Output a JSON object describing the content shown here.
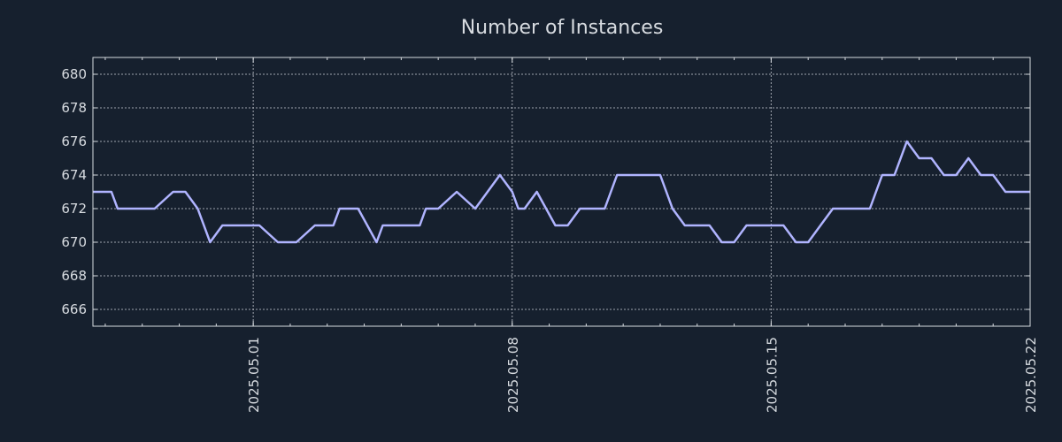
{
  "chart_data": {
    "type": "line",
    "title": "Number of Instances",
    "xlabel": "",
    "ylabel": "",
    "xlim": [
      "2025-04-26T16:00",
      "2025-05-22T00:00"
    ],
    "ylim": [
      665,
      681
    ],
    "yticks": [
      666,
      668,
      670,
      672,
      674,
      676,
      678,
      680
    ],
    "xticks": [
      "2025.05.01",
      "2025.05.08",
      "2025.05.15",
      "2025.05.22"
    ],
    "grid": true,
    "legend": "none",
    "line_color": "#b0b4ff",
    "series": [
      {
        "x": [
          "2025-04-26T16:00",
          "2025-04-27T04:00",
          "2025-04-27T08:00",
          "2025-04-27T20:00",
          "2025-04-28T08:00",
          "2025-04-28T20:00",
          "2025-04-29T04:00",
          "2025-04-29T12:00",
          "2025-04-29T20:00",
          "2025-04-30T04:00",
          "2025-04-30T08:00",
          "2025-04-30T12:00",
          "2025-04-30T20:00",
          "2025-05-01T04:00",
          "2025-05-01T16:00",
          "2025-05-02T04:00",
          "2025-05-02T16:00",
          "2025-05-03T04:00",
          "2025-05-03T08:00",
          "2025-05-03T20:00",
          "2025-05-04T08:00",
          "2025-05-04T12:00",
          "2025-05-04T20:00",
          "2025-05-05T04:00",
          "2025-05-05T12:00",
          "2025-05-05T16:00",
          "2025-05-06T00:00",
          "2025-05-06T12:00",
          "2025-05-07T00:00",
          "2025-05-07T08:00",
          "2025-05-07T16:00",
          "2025-05-08T00:00",
          "2025-05-08T04:00",
          "2025-05-08T08:00",
          "2025-05-08T16:00",
          "2025-05-09T04:00",
          "2025-05-09T12:00",
          "2025-05-09T20:00",
          "2025-05-10T04:00",
          "2025-05-10T12:00",
          "2025-05-10T20:00",
          "2025-05-11T04:00",
          "2025-05-11T08:00",
          "2025-05-11T12:00",
          "2025-05-11T16:00",
          "2025-05-12T00:00",
          "2025-05-12T08:00",
          "2025-05-12T16:00",
          "2025-05-13T00:00",
          "2025-05-13T08:00",
          "2025-05-13T16:00",
          "2025-05-14T00:00",
          "2025-05-14T08:00",
          "2025-05-14T16:00",
          "2025-05-15T00:00",
          "2025-05-15T08:00",
          "2025-05-15T16:00",
          "2025-05-16T00:00",
          "2025-05-16T08:00",
          "2025-05-16T16:00",
          "2025-05-17T00:00",
          "2025-05-17T08:00",
          "2025-05-17T16:00",
          "2025-05-18T00:00",
          "2025-05-18T08:00",
          "2025-05-18T16:00",
          "2025-05-19T00:00",
          "2025-05-19T08:00",
          "2025-05-19T16:00",
          "2025-05-20T00:00",
          "2025-05-20T08:00",
          "2025-05-20T16:00",
          "2025-05-21T00:00",
          "2025-05-21T08:00",
          "2025-05-21T16:00",
          "2025-05-22T00:00"
        ],
        "y": [
          673,
          673,
          672,
          672,
          672,
          673,
          673,
          672,
          670,
          671,
          671,
          671,
          671,
          671,
          670,
          670,
          671,
          671,
          672,
          672,
          670,
          671,
          671,
          671,
          671,
          672,
          672,
          673,
          672,
          673,
          674,
          673,
          672,
          672,
          673,
          671,
          671,
          672,
          672,
          672,
          674,
          674,
          674,
          674,
          674,
          674,
          672,
          671,
          671,
          671,
          670,
          670,
          671,
          671,
          671,
          671,
          670,
          670,
          671,
          672,
          672,
          672,
          672,
          674,
          674,
          676,
          675,
          675,
          674,
          674,
          675,
          674,
          674,
          673,
          673,
          673
        ]
      }
    ]
  }
}
